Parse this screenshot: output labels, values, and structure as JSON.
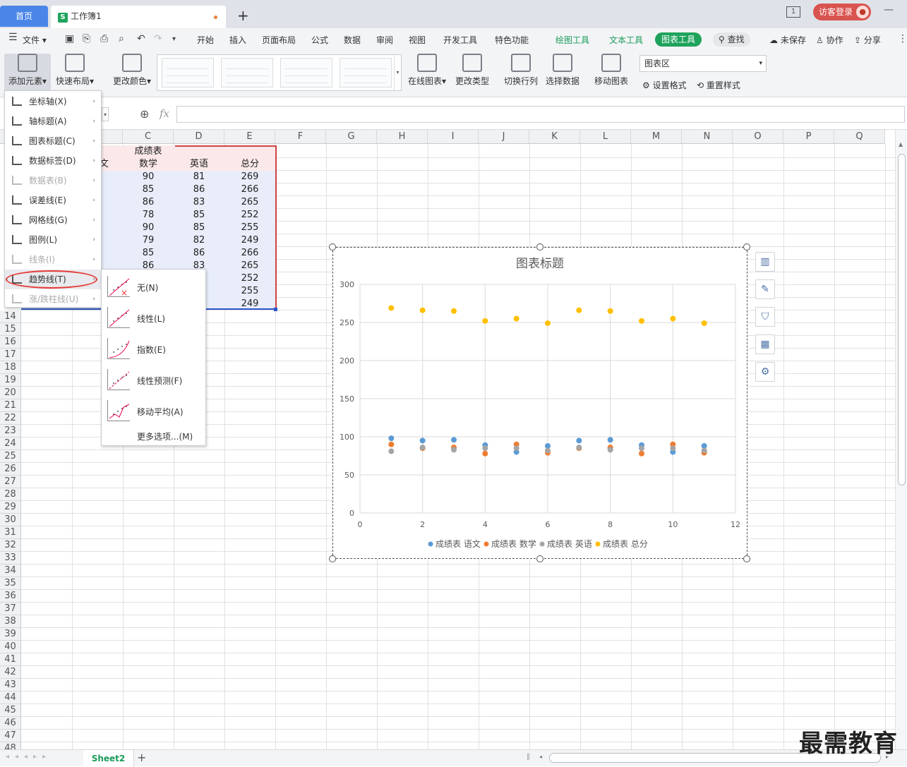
{
  "titlebar": {
    "home_tab": "首页",
    "doc_tab": "工作簿1",
    "doc_icon": "S",
    "add_tab": "+",
    "page_indicator": "1",
    "login": "访客登录"
  },
  "menubar": {
    "file": "文件",
    "items": [
      "开始",
      "插入",
      "页面布局",
      "公式",
      "数据",
      "审阅",
      "视图",
      "开发工具",
      "特色功能"
    ],
    "context_tabs": [
      "绘图工具",
      "文本工具",
      "图表工具"
    ],
    "search": "查找",
    "unsaved": "未保存",
    "collab": "协作",
    "share": "分享"
  },
  "ribbon": {
    "add_element": "添加元素",
    "quick_layout": "快速布局",
    "change_color": "更改颜色",
    "online_chart": "在线图表",
    "change_type": "更改类型",
    "switch_rowcol": "切换行列",
    "select_data": "选择数据",
    "move_chart": "移动图表",
    "chart_area_select": "图表区",
    "set_format": "设置格式",
    "reset_style": "重置样式"
  },
  "formulabar": {
    "fx": "fx"
  },
  "grid": {
    "columns": [
      "C",
      "D",
      "E",
      "F",
      "G",
      "H",
      "I",
      "J",
      "K",
      "L",
      "M",
      "N",
      "O",
      "P",
      "Q"
    ],
    "row_numbers": [
      "14",
      "15",
      "16",
      "17",
      "18",
      "19",
      "20",
      "21",
      "22",
      "23",
      "24",
      "25",
      "26",
      "27",
      "28",
      "29",
      "30",
      "31",
      "32",
      "33",
      "34",
      "35",
      "36",
      "37",
      "38",
      "39",
      "40",
      "41",
      "42",
      "43",
      "44",
      "45",
      "46",
      "47",
      "48"
    ],
    "table_title": "成绩表",
    "headers": [
      "文",
      "数学",
      "英语",
      "总分"
    ],
    "rows": [
      [
        "90",
        "81",
        "269"
      ],
      [
        "85",
        "86",
        "266"
      ],
      [
        "86",
        "83",
        "265"
      ],
      [
        "78",
        "85",
        "252"
      ],
      [
        "90",
        "85",
        "255"
      ],
      [
        "79",
        "82",
        "249"
      ],
      [
        "85",
        "86",
        "266"
      ],
      [
        "86",
        "83",
        "265"
      ],
      [
        "",
        "",
        "252"
      ],
      [
        "",
        "",
        "255"
      ],
      [
        "",
        "",
        "249"
      ]
    ]
  },
  "add_element_menu": [
    {
      "label": "坐标轴(X)",
      "icon": "axis-icon",
      "disabled": false,
      "submenu": true
    },
    {
      "label": "轴标题(A)",
      "icon": "axis-title-icon",
      "disabled": false,
      "submenu": true
    },
    {
      "label": "图表标题(C)",
      "icon": "chart-title-icon",
      "disabled": false,
      "submenu": true
    },
    {
      "label": "数据标签(D)",
      "icon": "data-label-icon",
      "disabled": false,
      "submenu": true
    },
    {
      "label": "数据表(B)",
      "icon": "data-table-icon",
      "disabled": true,
      "submenu": true
    },
    {
      "label": "误差线(E)",
      "icon": "error-bar-icon",
      "disabled": false,
      "submenu": true
    },
    {
      "label": "网格线(G)",
      "icon": "gridline-icon",
      "disabled": false,
      "submenu": true
    },
    {
      "label": "图例(L)",
      "icon": "legend-icon",
      "disabled": false,
      "submenu": true
    },
    {
      "label": "线条(I)",
      "icon": "line-icon",
      "disabled": true,
      "submenu": true
    },
    {
      "label": "趋势线(T)",
      "icon": "trendline-icon",
      "disabled": false,
      "submenu": true,
      "active": true
    },
    {
      "label": "涨/跌柱线(U)",
      "icon": "updown-bar-icon",
      "disabled": true,
      "submenu": true
    }
  ],
  "trendline_submenu": [
    {
      "label": "无(N)",
      "icon": "trend-none-icon"
    },
    {
      "label": "线性(L)",
      "icon": "trend-linear-icon"
    },
    {
      "label": "指数(E)",
      "icon": "trend-exponential-icon"
    },
    {
      "label": "线性预测(F)",
      "icon": "trend-forecast-icon"
    },
    {
      "label": "移动平均(A)",
      "icon": "trend-moving-average-icon"
    },
    {
      "label": "更多选项...(M)",
      "icon": ""
    }
  ],
  "statusbar": {
    "sheet": "Sheet2",
    "add_sheet": "+"
  },
  "watermark": "最需教育",
  "colors": {
    "accent_green": "#1fa35c",
    "home_blue": "#4a86e8",
    "series_blue": "#5b9bd5",
    "series_orange": "#ed7d31",
    "series_gray": "#a5a5a5",
    "series_yellow": "#ffc000"
  },
  "chart_data": {
    "type": "scatter",
    "title": "图表标题",
    "xlim": [
      0,
      12
    ],
    "ylim": [
      0,
      300
    ],
    "xticks": [
      "0",
      "2",
      "4",
      "6",
      "8",
      "10",
      "12"
    ],
    "yticks": [
      "0",
      "50",
      "100",
      "150",
      "200",
      "250",
      "300"
    ],
    "grid": true,
    "legend_position": "bottom",
    "series": [
      {
        "name": "成绩表 语文",
        "color": "#5b9bd5",
        "points": [
          [
            1,
            98
          ],
          [
            2,
            95
          ],
          [
            3,
            96
          ],
          [
            4,
            89
          ],
          [
            5,
            80
          ],
          [
            6,
            88
          ],
          [
            7,
            95
          ],
          [
            8,
            96
          ],
          [
            9,
            89
          ],
          [
            10,
            80
          ],
          [
            11,
            88
          ]
        ]
      },
      {
        "name": "成绩表 数学",
        "color": "#ed7d31",
        "points": [
          [
            1,
            90
          ],
          [
            2,
            85
          ],
          [
            3,
            86
          ],
          [
            4,
            78
          ],
          [
            5,
            90
          ],
          [
            6,
            79
          ],
          [
            7,
            85
          ],
          [
            8,
            86
          ],
          [
            9,
            78
          ],
          [
            10,
            90
          ],
          [
            11,
            79
          ]
        ]
      },
      {
        "name": "成绩表 英语",
        "color": "#a5a5a5",
        "points": [
          [
            1,
            81
          ],
          [
            2,
            86
          ],
          [
            3,
            83
          ],
          [
            4,
            85
          ],
          [
            5,
            85
          ],
          [
            6,
            82
          ],
          [
            7,
            86
          ],
          [
            8,
            83
          ],
          [
            9,
            85
          ],
          [
            10,
            85
          ],
          [
            11,
            82
          ]
        ]
      },
      {
        "name": "成绩表 总分",
        "color": "#ffc000",
        "points": [
          [
            1,
            269
          ],
          [
            2,
            266
          ],
          [
            3,
            265
          ],
          [
            4,
            252
          ],
          [
            5,
            255
          ],
          [
            6,
            249
          ],
          [
            7,
            266
          ],
          [
            8,
            265
          ],
          [
            9,
            252
          ],
          [
            10,
            255
          ],
          [
            11,
            249
          ]
        ]
      }
    ]
  }
}
